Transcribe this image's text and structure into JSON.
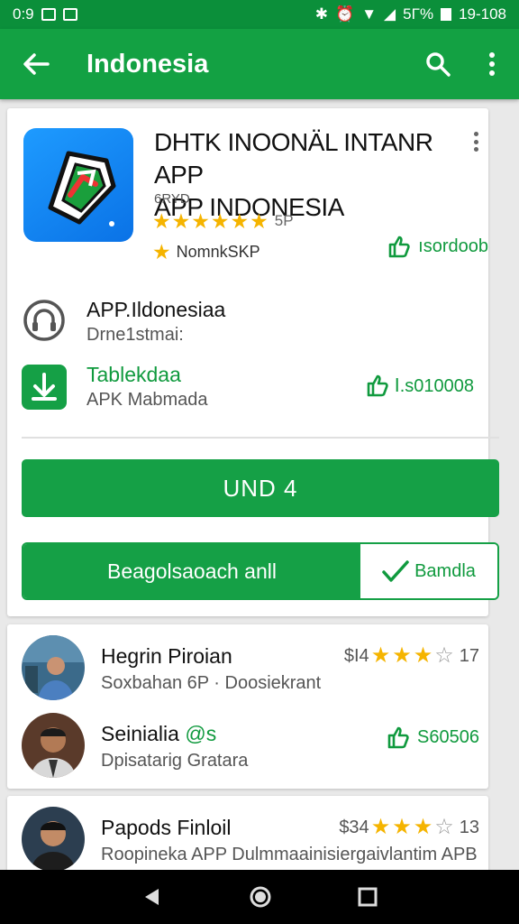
{
  "status_bar": {
    "time": "0:9",
    "battery_text": "5Γ%",
    "clock": "19-108"
  },
  "app_bar": {
    "title": "Indonesia"
  },
  "app": {
    "title_line1": "DHTK INOONÄL INTANR APP",
    "title_line2": "APP INDONESIA",
    "developer": "6RYD",
    "rating_count": "5P",
    "badge_text": "NomnkSKP",
    "installs_text": "ısordoob"
  },
  "info_rows": [
    {
      "title": "APP.Ildonesiaa",
      "subtitle": "Drne1stmai:"
    },
    {
      "title": "Tablekdaa",
      "subtitle": "APK Mabmada",
      "right": "Ⅰ.s010008"
    }
  ],
  "buttons": {
    "primary": "UND 4",
    "split_left": "Beagolsaoach anll",
    "split_right": "Bamdla"
  },
  "people": [
    {
      "name": "Hegrin Piroian",
      "subtitle": "Soxbahan 6P · Doosiekrant",
      "price": "$Ι4",
      "count": "17"
    },
    {
      "name": "Seinialia",
      "name_suffix": "@s",
      "subtitle": "Dpisatarig Gratara",
      "right": "S60506"
    },
    {
      "name": "Papods Finloil",
      "subtitle": "Roopineka APP Dulmmaainisiergaivlantim APB",
      "price": "$34",
      "count": "13"
    }
  ],
  "colors": {
    "status_bar": "#0b8f3a",
    "app_bar": "#13a143",
    "accent_green": "#15a046",
    "star": "#f5b400"
  }
}
